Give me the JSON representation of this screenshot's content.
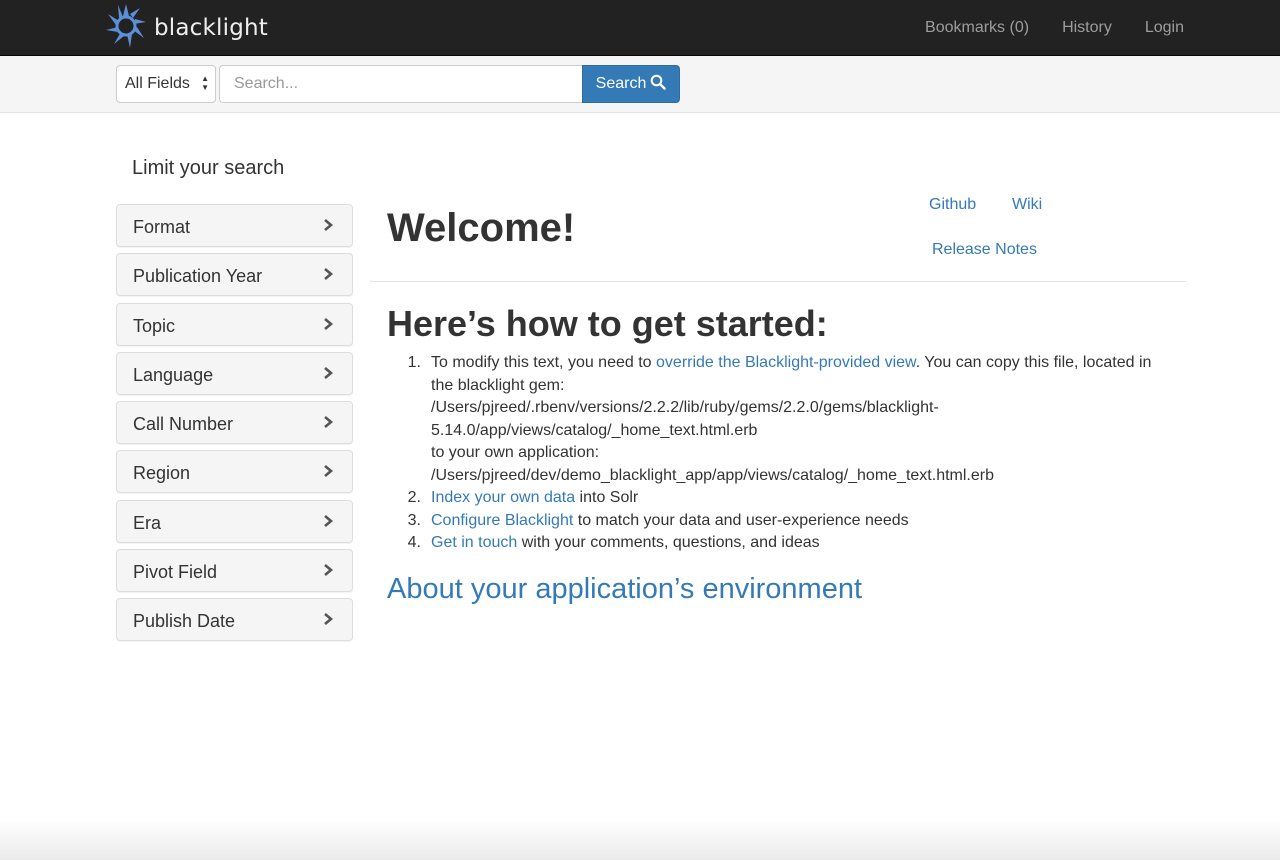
{
  "header": {
    "brand": "blacklight",
    "nav": [
      {
        "label": "Bookmarks (0)"
      },
      {
        "label": "History"
      },
      {
        "label": "Login"
      }
    ]
  },
  "search": {
    "field_selected": "All Fields",
    "placeholder": "Search...",
    "button_label": "Search"
  },
  "sidebar": {
    "title": "Limit your search",
    "facets": [
      {
        "label": "Format"
      },
      {
        "label": "Publication Year"
      },
      {
        "label": "Topic"
      },
      {
        "label": "Language"
      },
      {
        "label": "Call Number"
      },
      {
        "label": "Region"
      },
      {
        "label": "Era"
      },
      {
        "label": "Pivot Field"
      },
      {
        "label": "Publish Date"
      }
    ]
  },
  "main": {
    "welcome": "Welcome!",
    "links": {
      "github": "Github",
      "wiki": "Wiki",
      "release_notes": "Release Notes"
    },
    "started_heading": "Here’s how to get started:",
    "steps": {
      "s1": {
        "num": "1.",
        "pre": "To modify this text, you need to ",
        "link": "override the Blacklight-provided view",
        "post": ". You can copy this file, located in the blacklight gem:",
        "path1": "/Users/pjreed/.rbenv/versions/2.2.2/lib/ruby/gems/2.2.0/gems/blacklight-5.14.0/app/views/catalog/_home_text.html.erb",
        "mid": "to your own application:",
        "path2": "/Users/pjreed/dev/demo_blacklight_app/app/views/catalog/_home_text.html.erb"
      },
      "s2": {
        "num": "2.",
        "link": "Index your own data",
        "post": " into Solr"
      },
      "s3": {
        "num": "3.",
        "link": "Configure Blacklight",
        "post": " to match your data and user-experience needs"
      },
      "s4": {
        "num": "4.",
        "link": "Get in touch",
        "post": " with your comments, questions, and ideas"
      }
    },
    "about_heading": "About your application’s environment"
  },
  "colors": {
    "link": "#337ab7",
    "navbar": "#222222",
    "logo_blue": "#6a9bd8"
  }
}
